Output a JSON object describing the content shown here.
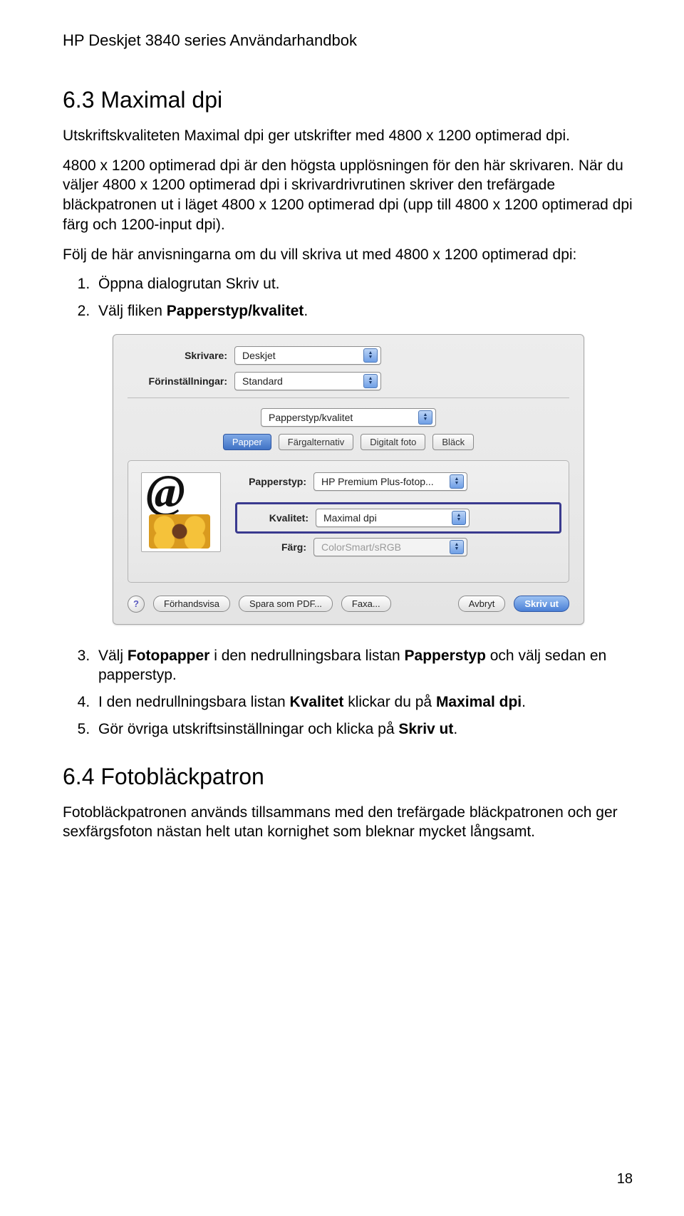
{
  "header": "HP Deskjet 3840 series Användarhandbok",
  "section63": {
    "title": "6.3  Maximal dpi",
    "p1": "Utskriftskvaliteten Maximal dpi ger utskrifter med 4800 x 1200 optimerad dpi.",
    "p2": "4800 x 1200 optimerad dpi är den högsta upplösningen för den här skrivaren. När du väljer 4800 x 1200 optimerad dpi i skrivardrivrutinen skriver den trefärgade bläckpatronen ut i läget 4800 x 1200 optimerad dpi (upp till 4800 x 1200 optimerad dpi färg och 1200-input dpi).",
    "p3": "Följ de här anvisningarna om du vill skriva ut med 4800 x 1200 optimerad dpi:",
    "step1_a": "Öppna dialogrutan ",
    "step1_b": "Skriv ut",
    "step1_c": ".",
    "step2_a": "Välj fliken ",
    "step2_b": "Papperstyp/kvalitet",
    "step2_c": ".",
    "step3_a": "Välj ",
    "step3_b": "Fotopapper",
    "step3_c": " i den nedrullningsbara listan ",
    "step3_d": "Papperstyp",
    "step3_e": " och välj sedan en papperstyp.",
    "step4_a": "I den nedrullningsbara listan ",
    "step4_b": "Kvalitet",
    "step4_c": " klickar du på ",
    "step4_d": "Maximal dpi",
    "step4_e": ".",
    "step5_a": "Gör övriga utskriftsinställningar och klicka på ",
    "step5_b": "Skriv ut",
    "step5_c": "."
  },
  "section64": {
    "title": "6.4  Fotobläckpatron",
    "p1": "Fotobläckpatronen används tillsammans med den trefärgade bläckpatronen och ger sexfärgsfoton nästan helt utan kornighet som bleknar mycket långsamt."
  },
  "dialog": {
    "printer_label": "Skrivare:",
    "printer_value": "Deskjet",
    "preset_label": "Förinställningar:",
    "preset_value": "Standard",
    "pane_value": "Papperstyp/kvalitet",
    "tabs": {
      "papper": "Papper",
      "farg": "Färgalternativ",
      "digitalt": "Digitalt foto",
      "black": "Bläck"
    },
    "papperstyp_label": "Papperstyp:",
    "papperstyp_value": "HP Premium Plus-fotop...",
    "kvalitet_label": "Kvalitet:",
    "kvalitet_value": "Maximal dpi",
    "farg_label": "Färg:",
    "farg_value": "ColorSmart/sRGB",
    "buttons": {
      "preview": "Förhandsvisa",
      "save_pdf": "Spara som PDF...",
      "fax": "Faxa...",
      "cancel": "Avbryt",
      "print": "Skriv ut"
    }
  },
  "page_number": "18"
}
